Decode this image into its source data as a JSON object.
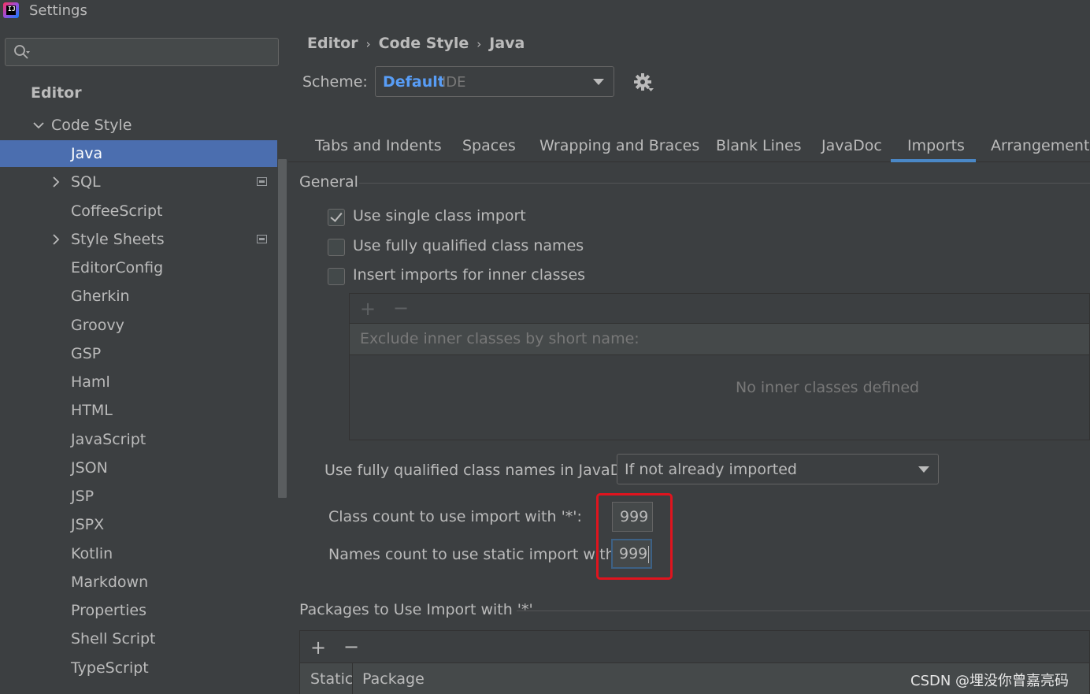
{
  "window": {
    "title": "Settings",
    "app_icon": "intellij-idea-icon"
  },
  "sidebar": {
    "search": {
      "value": "",
      "icon": "search-icon"
    },
    "section_header": "Editor",
    "code_style": "Code Style",
    "items": [
      {
        "label": "Java",
        "selected": true
      },
      {
        "label": "SQL",
        "expandable": true
      },
      {
        "label": "CoffeeScript"
      },
      {
        "label": "Style Sheets",
        "expandable": true
      },
      {
        "label": "EditorConfig"
      },
      {
        "label": "Gherkin"
      },
      {
        "label": "Groovy"
      },
      {
        "label": "GSP"
      },
      {
        "label": "Haml"
      },
      {
        "label": "HTML"
      },
      {
        "label": "JavaScript"
      },
      {
        "label": "JSON"
      },
      {
        "label": "JSP"
      },
      {
        "label": "JSPX"
      },
      {
        "label": "Kotlin"
      },
      {
        "label": "Markdown"
      },
      {
        "label": "Properties"
      },
      {
        "label": "Shell Script"
      },
      {
        "label": "TypeScript"
      }
    ]
  },
  "breadcrumb": {
    "items": [
      "Editor",
      "Code Style",
      "Java"
    ],
    "separator": "›"
  },
  "scheme": {
    "label": "Scheme:",
    "value": "Default",
    "suffix": "IDE"
  },
  "tabs": [
    {
      "label": "Tabs and Indents"
    },
    {
      "label": "Spaces"
    },
    {
      "label": "Wrapping and Braces"
    },
    {
      "label": "Blank Lines"
    },
    {
      "label": "JavaDoc"
    },
    {
      "label": "Imports",
      "active": true
    },
    {
      "label": "Arrangement"
    }
  ],
  "general": {
    "title": "General",
    "options": [
      {
        "label": "Use single class import",
        "checked": true
      },
      {
        "label": "Use fully qualified class names",
        "checked": false
      },
      {
        "label": "Insert imports for inner classes",
        "checked": false
      }
    ],
    "inner_classes": {
      "add": "+",
      "remove": "−",
      "header": "Exclude inner classes by short name:",
      "empty": "No inner classes defined"
    },
    "javadoc": {
      "label": "Use fully qualified class names in JavaDoc:",
      "value": "If not already imported"
    },
    "class_count": {
      "label": "Class count to use import with '*':",
      "value": "999"
    },
    "names_count": {
      "label": "Names count to use static import with '*':",
      "value": "999"
    }
  },
  "packages": {
    "title": "Packages to Use Import with '*'",
    "add": "+",
    "remove": "−",
    "columns": [
      "Static",
      "Package"
    ]
  },
  "watermark": "CSDN @埋没你曾嘉亮码",
  "colors": {
    "background": "#3c3f41",
    "selection": "#4b6eaf",
    "accent": "#4a88c7",
    "link_blue": "#589df6",
    "highlight_red": "#e0141e"
  }
}
